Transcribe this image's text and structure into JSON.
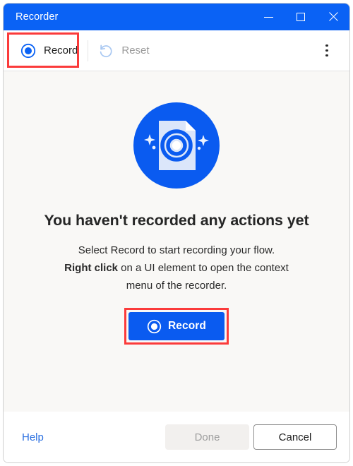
{
  "window": {
    "title": "Recorder",
    "controls": {
      "minimize": "minimize-icon",
      "maximize": "maximize-icon",
      "close": "close-icon"
    },
    "titlebar_color": "#0a62f5"
  },
  "toolbar": {
    "record_label": "Record",
    "record_icon": "record-circle-icon",
    "reset_label": "Reset",
    "reset_icon": "undo-arrow-icon",
    "reset_disabled": true,
    "overflow_icon": "more-vertical-icon",
    "annotation_color": "#fb3b3b"
  },
  "main": {
    "illustration_icon": "recorder-document-target-icon",
    "heading": "You haven't recorded any actions yet",
    "body_line1": "Select Record to start recording your flow.",
    "body_line2_bold": "Right click",
    "body_line2_rest": " on a UI element to open the context",
    "body_line3": "menu of the recorder.",
    "cta_label": "Record",
    "cta_icon": "record-circle-icon",
    "cta_color": "#0a5bf0",
    "background": "#f9f8f6"
  },
  "footer": {
    "help_label": "Help",
    "help_color": "#2a6fe0",
    "done_label": "Done",
    "done_disabled": true,
    "cancel_label": "Cancel"
  }
}
